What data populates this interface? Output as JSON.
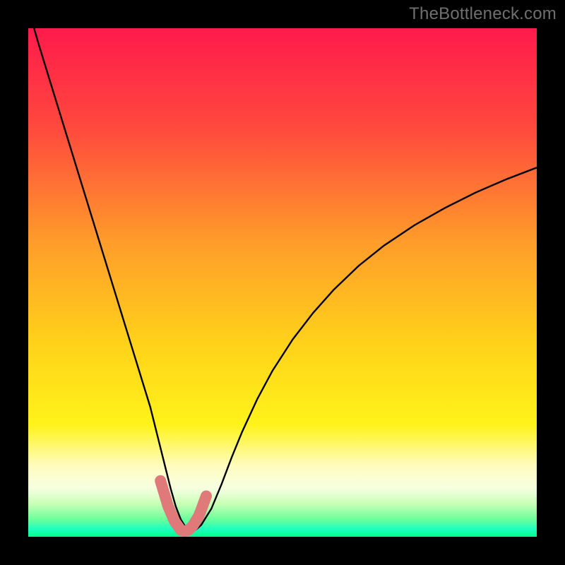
{
  "watermark": {
    "text": "TheBottleneck.com"
  },
  "chart_data": {
    "type": "line",
    "title": "",
    "xlabel": "",
    "ylabel": "",
    "xlim": [
      0,
      100
    ],
    "ylim": [
      0,
      100
    ],
    "grid": false,
    "legend": false,
    "background_gradient": {
      "stops": [
        {
          "pos": 0.0,
          "color": "#ff1a4b"
        },
        {
          "pos": 0.2,
          "color": "#ff4a3d"
        },
        {
          "pos": 0.42,
          "color": "#ff9c2a"
        },
        {
          "pos": 0.62,
          "color": "#ffd21a"
        },
        {
          "pos": 0.78,
          "color": "#fff31a"
        },
        {
          "pos": 0.86,
          "color": "#fffcbf"
        },
        {
          "pos": 0.905,
          "color": "#f6ffe0"
        },
        {
          "pos": 0.935,
          "color": "#c9ffb7"
        },
        {
          "pos": 0.965,
          "color": "#6fff9c"
        },
        {
          "pos": 0.985,
          "color": "#1fffbf"
        },
        {
          "pos": 1.0,
          "color": "#00ff8c"
        }
      ]
    },
    "series": [
      {
        "name": "bottleneck-curve",
        "color": "#000000",
        "stroke_width": 2.4,
        "x": [
          0.0,
          2,
          4,
          6,
          8,
          10,
          12,
          14,
          16,
          18,
          20,
          22,
          24,
          26,
          27,
          28,
          29,
          30,
          31,
          32,
          33,
          34,
          36,
          38,
          40,
          42,
          45,
          48,
          52,
          56,
          60,
          65,
          70,
          76,
          82,
          88,
          94,
          100
        ],
        "y": [
          104,
          97,
          90.5,
          84,
          77.5,
          71,
          64.5,
          58,
          51.5,
          45,
          38.5,
          32,
          25.5,
          17.5,
          13.5,
          9.5,
          6.0,
          3.4,
          1.8,
          1.2,
          1.4,
          2.3,
          5.5,
          10.3,
          15.6,
          20.5,
          27.0,
          32.6,
          38.8,
          44.0,
          48.5,
          53.3,
          57.3,
          61.3,
          64.7,
          67.7,
          70.3,
          72.6
        ]
      },
      {
        "name": "minimum-marker",
        "color": "#e07a7a",
        "stroke_width": 16,
        "linecap": "round",
        "x": [
          26.0,
          27.5,
          28.8,
          30.0,
          30.8,
          31.5,
          32.4,
          33.6,
          35.0
        ],
        "y": [
          11.0,
          6.0,
          3.0,
          1.3,
          1.1,
          1.3,
          2.2,
          4.2,
          8.0
        ]
      }
    ]
  }
}
